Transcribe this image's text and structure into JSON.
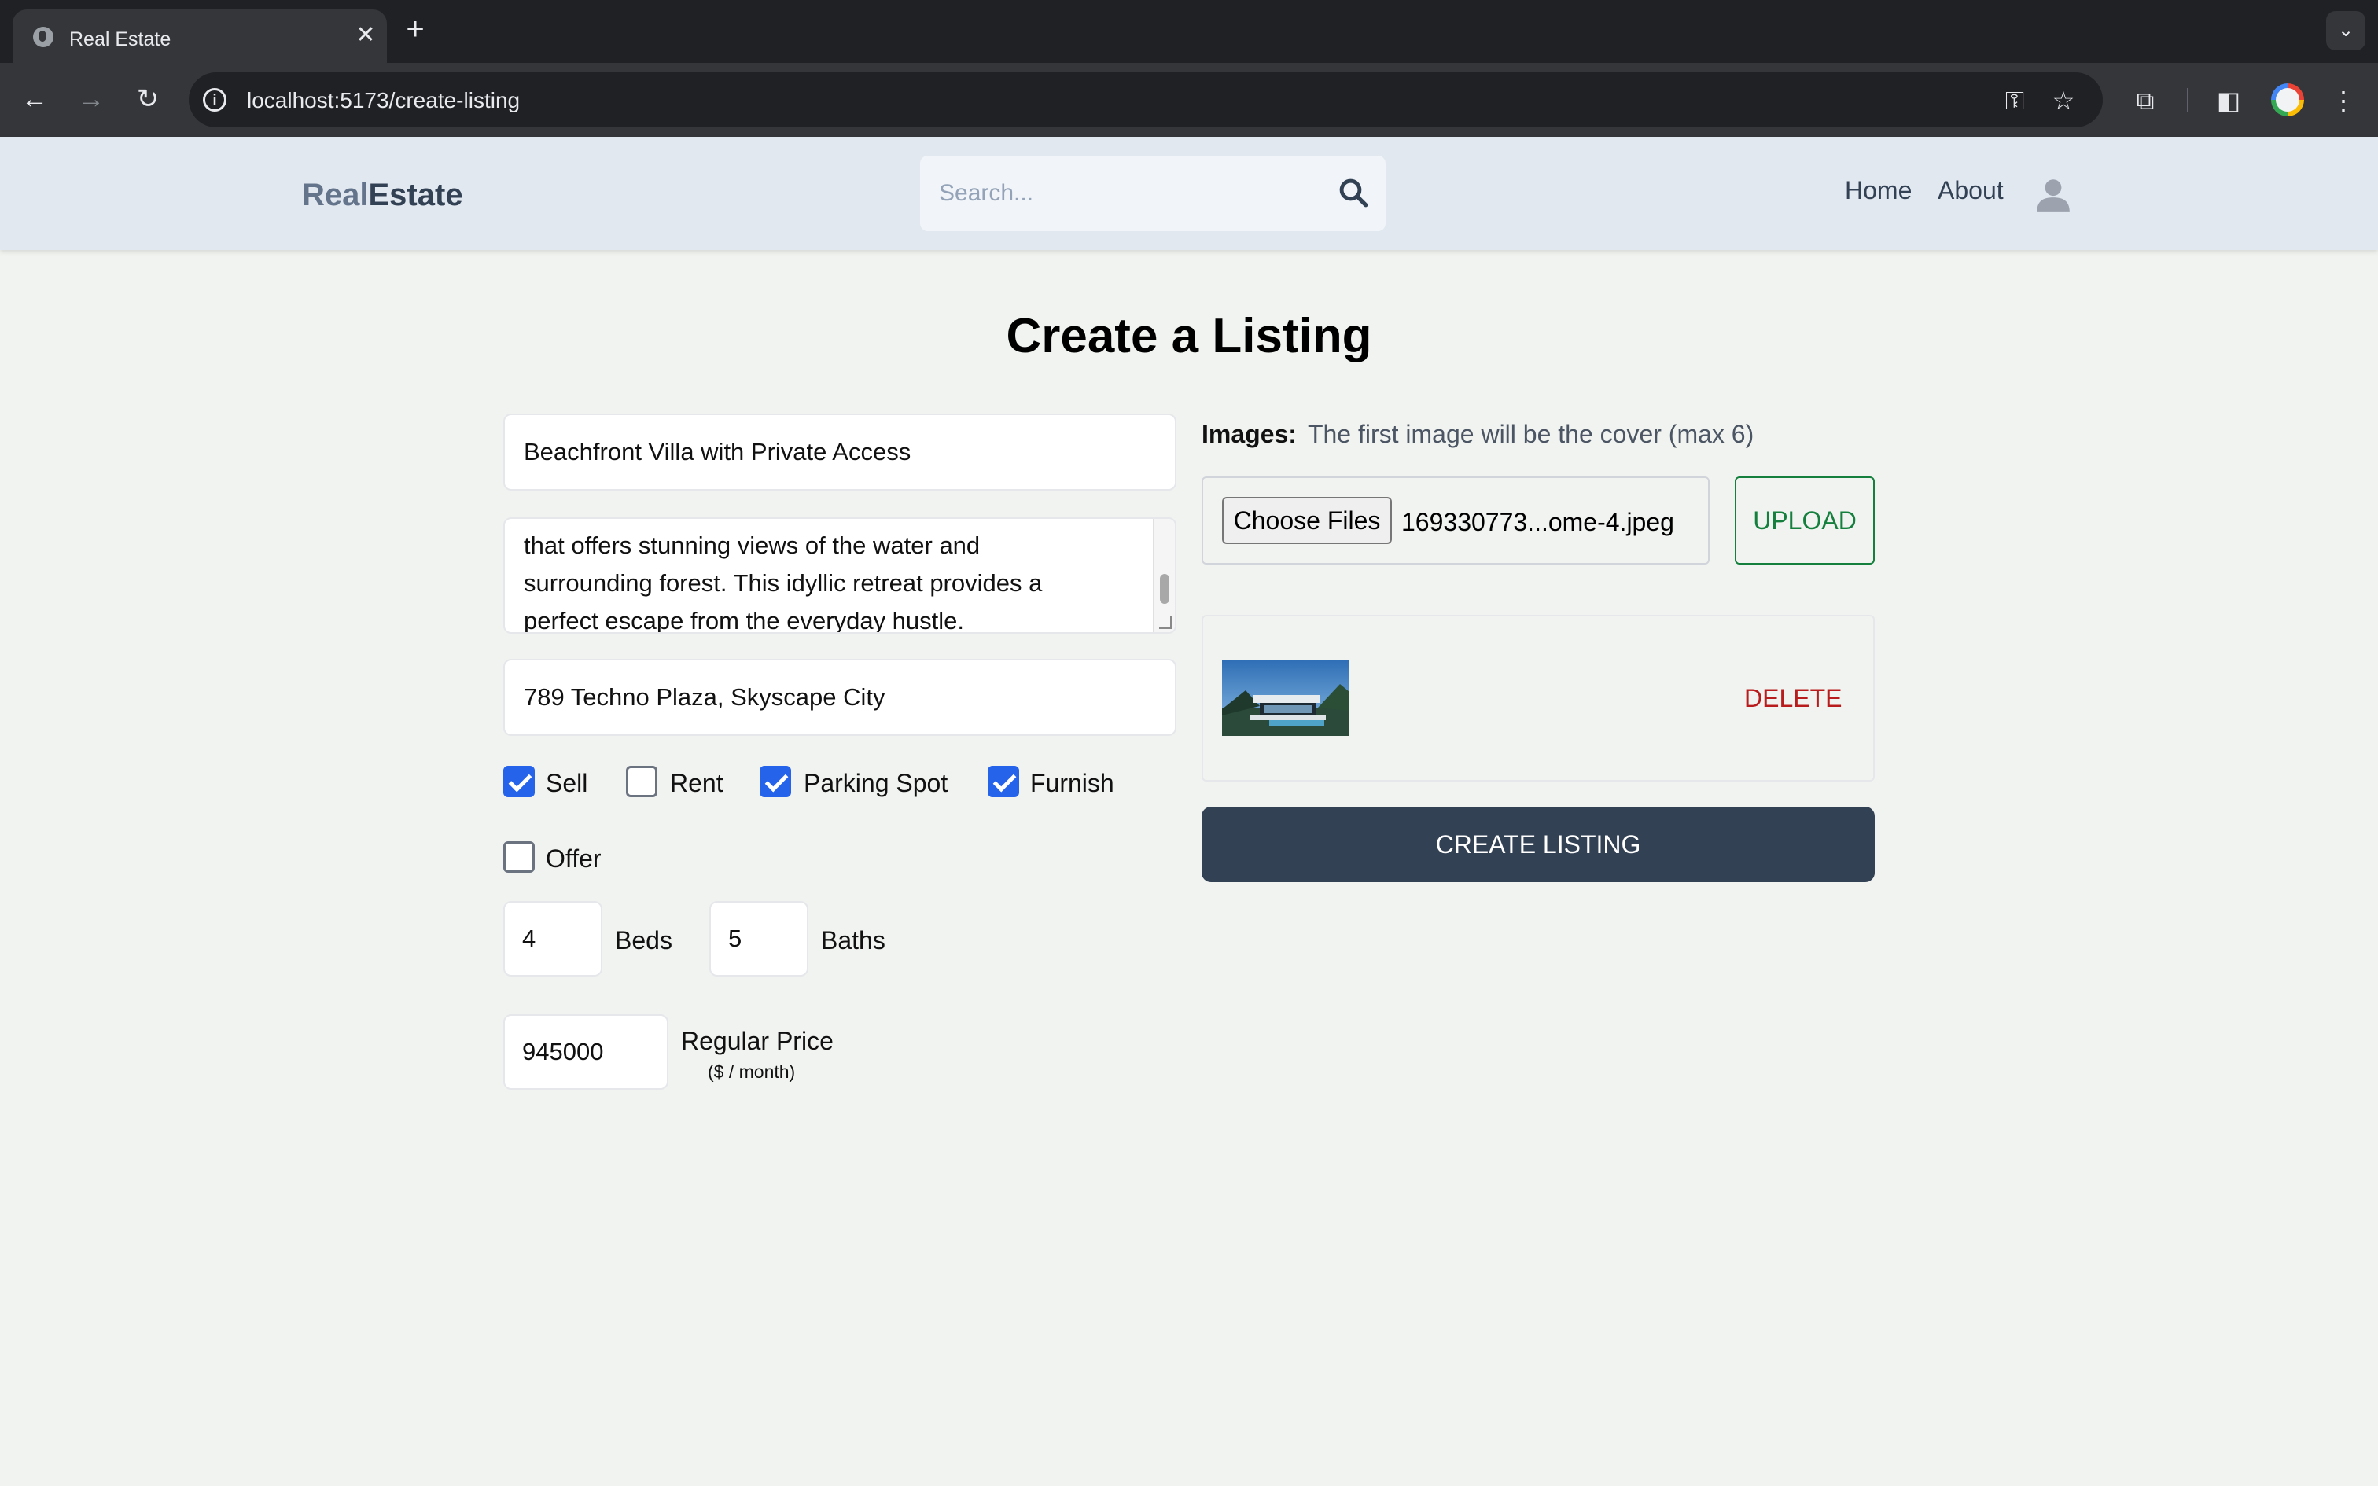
{
  "browser": {
    "tab_title": "Real Estate",
    "tab_close": "✕",
    "new_tab": "+",
    "url": "localhost:5173/create-listing"
  },
  "header": {
    "logo_part1": "Real",
    "logo_part2": "Estate",
    "search_placeholder": "Search...",
    "nav": {
      "home": "Home",
      "about": "About"
    }
  },
  "page": {
    "title": "Create a Listing"
  },
  "form": {
    "name": "Beachfront Villa with Private Access",
    "description_lines": [
      "that offers stunning views of the water and",
      "surrounding forest. This idyllic retreat provides a",
      "perfect escape from the everyday hustle."
    ],
    "address": "789 Techno Plaza, Skyscape City",
    "checkboxes": [
      {
        "label": "Sell",
        "checked": true
      },
      {
        "label": "Rent",
        "checked": false
      },
      {
        "label": "Parking Spot",
        "checked": true
      },
      {
        "label": "Furnish",
        "checked": true
      },
      {
        "label": "Offer",
        "checked": false
      }
    ],
    "beds": "4",
    "beds_label": "Beds",
    "baths": "5",
    "baths_label": "Baths",
    "regular_price": "945000",
    "regular_price_label": "Regular Price",
    "regular_price_unit": "($ / month)"
  },
  "images": {
    "label": "Images:",
    "note": "The first image will be the cover (max 6)",
    "choose_files": "Choose Files",
    "file_name": "169330773...ome-4.jpeg",
    "upload": "UPLOAD",
    "delete": "DELETE"
  },
  "submit": {
    "label": "CREATE LISTING"
  },
  "colors": {
    "accent_checkbox": "#2563eb",
    "upload_green": "#15803d",
    "delete_red": "#b91c1c",
    "create_button": "#334155",
    "header_bg": "#e2e8f0"
  }
}
